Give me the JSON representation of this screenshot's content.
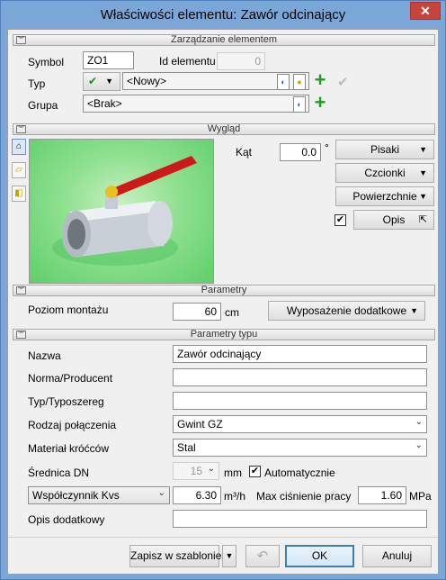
{
  "window": {
    "title": "Właściwości elementu: Zawór odcinający",
    "close": "✕"
  },
  "sections": {
    "manage": "Zarządzanie elementem",
    "look": "Wygląd",
    "params": "Parametry",
    "type_params": "Parametry typu"
  },
  "manage": {
    "symbol_label": "Symbol",
    "symbol_value": "ZO1",
    "id_label": "Id elementu",
    "id_value": "0",
    "type_label": "Typ",
    "type_value": "<Nowy>",
    "group_label": "Grupa",
    "group_value": "<Brak>"
  },
  "look": {
    "angle_label": "Kąt",
    "angle_value": "0.0",
    "angle_unit": "°",
    "pens": "Pisaki",
    "fonts": "Czcionki",
    "surfaces": "Powierzchnie",
    "desc": "Opis"
  },
  "params": {
    "mount_label": "Poziom montażu",
    "mount_value": "60",
    "mount_unit": "cm",
    "equipment": "Wyposażenie dodatkowe"
  },
  "type_params": {
    "name_label": "Nazwa",
    "name_value": "Zawór odcinający",
    "norm_label": "Norma/Producent",
    "norm_value": "",
    "series_label": "Typ/Typoszereg",
    "series_value": "",
    "conn_label": "Rodzaj połączenia",
    "conn_value": "Gwint GZ",
    "mat_label": "Materiał króćców",
    "mat_value": "Stal",
    "dn_label": "Średnica DN",
    "dn_value": "15",
    "dn_unit": "mm",
    "auto_label": "Automatycznie",
    "kvs_select": "Współczynnik Kvs",
    "kvs_value": "6.30",
    "kvs_unit": "m³/h",
    "maxp_label": "Max ciśnienie pracy",
    "maxp_value": "1.60",
    "maxp_unit": "MPa",
    "extra_label": "Opis dodatkowy",
    "extra_value": ""
  },
  "footer": {
    "save_template": "Zapisz w szablonie",
    "ok": "OK",
    "cancel": "Anuluj"
  }
}
